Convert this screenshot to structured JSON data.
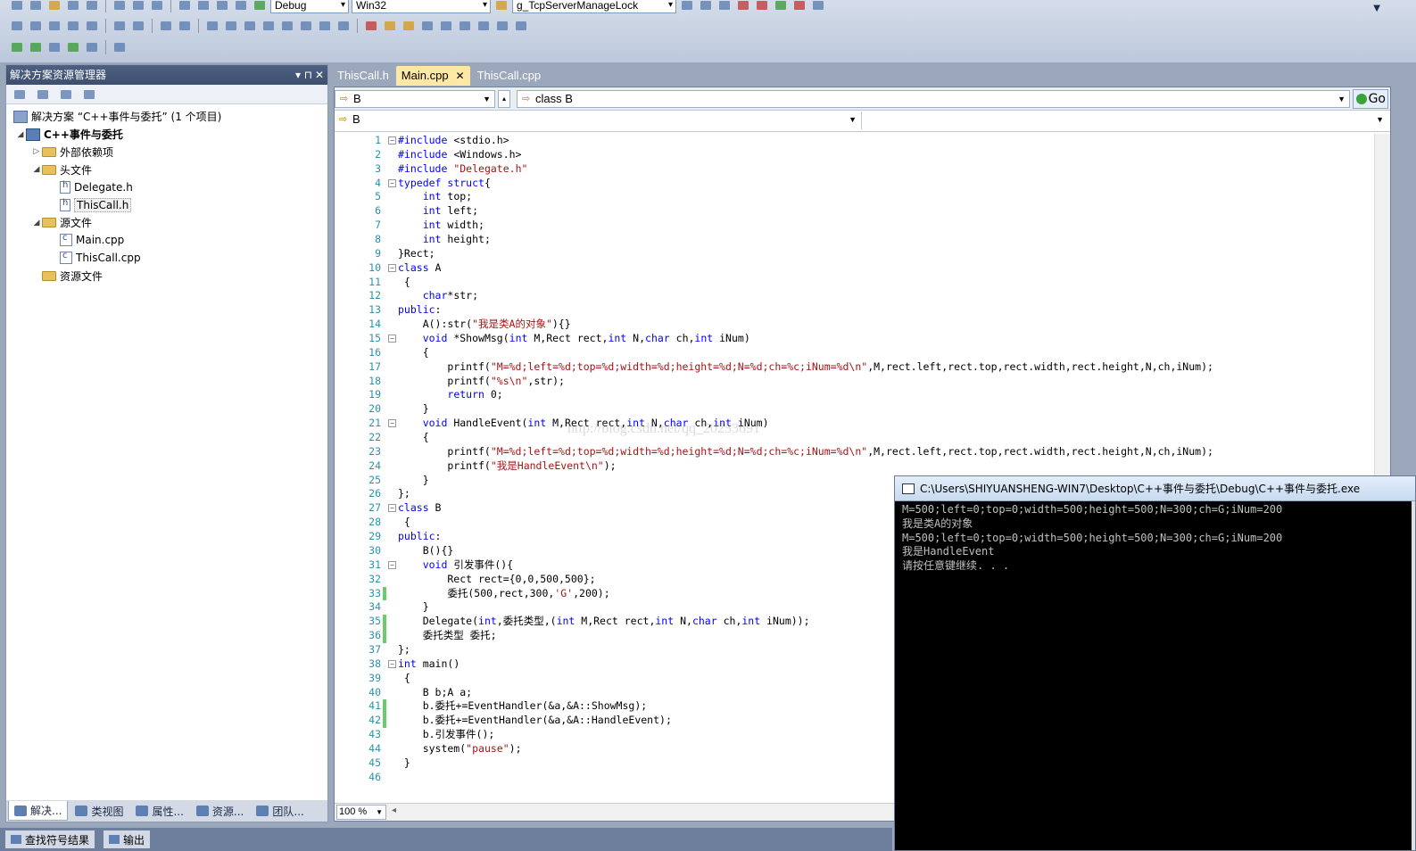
{
  "toolbar": {
    "config": "Debug",
    "platform": "Win32",
    "find_value": "g_TcpServerManageLock"
  },
  "solution_explorer": {
    "title": "解决方案资源管理器",
    "solution_label": "解决方案 “C++事件与委托” (1 个项目)",
    "project_label": "C++事件与委托",
    "items": [
      {
        "label": "外部依赖项",
        "icon": "folder-icon",
        "level": 2,
        "arrow": "▷"
      },
      {
        "label": "头文件",
        "icon": "folder-icon",
        "level": 2,
        "arrow": "◢"
      },
      {
        "label": "Delegate.h",
        "icon": "header-file-icon",
        "level": 3,
        "arrow": ""
      },
      {
        "label": "ThisCall.h",
        "icon": "header-file-icon",
        "level": 3,
        "arrow": "",
        "selected": true
      },
      {
        "label": "源文件",
        "icon": "folder-icon",
        "level": 2,
        "arrow": "◢"
      },
      {
        "label": "Main.cpp",
        "icon": "cpp-file-icon",
        "level": 3,
        "arrow": ""
      },
      {
        "label": "ThisCall.cpp",
        "icon": "cpp-file-icon",
        "level": 3,
        "arrow": ""
      },
      {
        "label": "资源文件",
        "icon": "folder-icon",
        "level": 2,
        "arrow": ""
      }
    ],
    "bottom_tabs": [
      "解决...",
      "类视图",
      "属性...",
      "资源...",
      "团队..."
    ]
  },
  "bottom_strip": [
    "查找符号结果",
    "输出"
  ],
  "editor": {
    "tabs": [
      {
        "label": "ThisCall.h",
        "active": false
      },
      {
        "label": "Main.cpp",
        "active": true
      },
      {
        "label": "ThisCall.cpp",
        "active": false
      }
    ],
    "scope_combo": "B",
    "member_combo": "class B",
    "second_combo": "B",
    "go_label": "Go",
    "zoom": "100 %",
    "watermark": "http://blog.csdn.net/qq_20253691",
    "lines": [
      "#include <stdio.h>",
      "#include <Windows.h>",
      "#include \"Delegate.h\"",
      "typedef struct{",
      "    int top;",
      "    int left;",
      "    int width;",
      "    int height;",
      "}Rect;",
      "class A",
      " {",
      "    char*str;",
      "public:",
      "    A():str(\"我是类A的对象\"){}",
      "    void *ShowMsg(int M,Rect rect,int N,char ch,int iNum)",
      "    {",
      "        printf(\"M=%d;left=%d;top=%d;width=%d;height=%d;N=%d;ch=%c;iNum=%d\\n\",M,rect.left,rect.top,rect.width,rect.height,N,ch,iNum);",
      "        printf(\"%s\\n\",str);",
      "        return 0;",
      "    }",
      "    void HandleEvent(int M,Rect rect,int N,char ch,int iNum)",
      "    {",
      "        printf(\"M=%d;left=%d;top=%d;width=%d;height=%d;N=%d;ch=%c;iNum=%d\\n\",M,rect.left,rect.top,rect.width,rect.height,N,ch,iNum);",
      "        printf(\"我是HandleEvent\\n\");",
      "    }",
      "};",
      "class B",
      " {",
      "public:",
      "    B(){}",
      "    void 引发事件(){",
      "        Rect rect={0,0,500,500};",
      "        委托(500,rect,300,'G',200);",
      "    }",
      "    Delegate(int,委托类型,(int M,Rect rect,int N,char ch,int iNum));",
      "    委托类型 委托;",
      "};",
      "int main()",
      " {",
      "    B b;A a;",
      "    b.委托+=EventHandler(&a,&A::ShowMsg);",
      "    b.委托+=EventHandler(&a,&A::HandleEvent);",
      "    b.引发事件();",
      "    system(\"pause\");",
      " }",
      ""
    ],
    "fold_lines": [
      1,
      4,
      10,
      15,
      21,
      27,
      31,
      38
    ],
    "changed_lines": [
      33,
      35,
      36,
      41,
      42
    ]
  },
  "console": {
    "title": "C:\\Users\\SHIYUANSHENG-WIN7\\Desktop\\C++事件与委托\\Debug\\C++事件与委托.exe",
    "lines": [
      "M=500;left=0;top=0;width=500;height=500;N=300;ch=G;iNum=200",
      "我是类A的对象",
      "M=500;left=0;top=0;width=500;height=500;N=300;ch=G;iNum=200",
      "我是HandleEvent",
      "请按任意键继续. . ."
    ]
  }
}
